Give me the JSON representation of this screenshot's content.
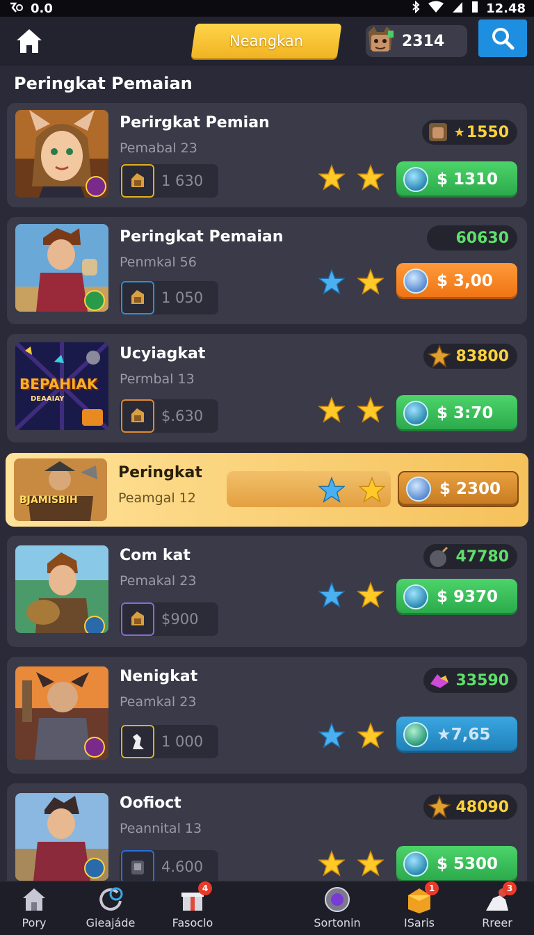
{
  "status": {
    "left_text": "0.0",
    "time": "12.48"
  },
  "header": {
    "tab_label": "Neangkan",
    "currency_value": "2314"
  },
  "section_title": "Peringkat Pemaian",
  "rows": [
    {
      "name": "Perirgkat Pemian",
      "sub": "Pemabal 23",
      "item_value": "1 630",
      "badge": "1550",
      "badge_color": "#ffd23a",
      "price": "$ 1310",
      "price_style": "green",
      "stars": [
        "gold",
        "gold"
      ]
    },
    {
      "name": "Peringkat Pemaian",
      "sub": "Penmkal 56",
      "item_value": "1 050",
      "badge": "60630",
      "badge_color": "#5ee06a",
      "price": "$ 3,00",
      "price_style": "orange",
      "stars": [
        "blue",
        "gold"
      ]
    },
    {
      "name": "Ucyiagkat",
      "sub": "Permbal 13",
      "item_value": "$.630",
      "badge": "83800",
      "badge_color": "#ffd23a",
      "price": "$ 3:70",
      "price_style": "green",
      "stars": [
        "gold",
        "gold"
      ]
    },
    {
      "name": "Peringkat",
      "sub": "Peamgal 12",
      "price": "$ 2300",
      "price_style": "gold",
      "stars": [
        "blue",
        "gold"
      ],
      "thumb_text": "BJAMISBIH"
    },
    {
      "name": "Com kat",
      "sub": "Pemakal 23",
      "item_value": "$900",
      "badge": "47780",
      "badge_color": "#5ee06a",
      "price": "$ 9370",
      "price_style": "green",
      "stars": [
        "blue",
        "gold"
      ]
    },
    {
      "name": "Nenigkat",
      "sub": "Peamkal 23",
      "item_value": "1 000",
      "badge": "33590",
      "badge_color": "#5ee06a",
      "price": "★7,65",
      "price_style": "blue",
      "stars": [
        "blue",
        "gold"
      ]
    },
    {
      "name": "Oofioct",
      "sub": "Peannital 13",
      "item_value": "4.600",
      "badge": "48090",
      "badge_color": "#ffd23a",
      "price": "$ 5300",
      "price_style": "green",
      "stars": [
        "gold",
        "gold"
      ]
    }
  ],
  "thumb3": {
    "title": "BEPAHIAK",
    "subtitle": "DEAAIAY"
  },
  "nav": [
    {
      "label": "Pory",
      "badge": ""
    },
    {
      "label": "Gieajáde",
      "badge": ""
    },
    {
      "label": "Fasoclo",
      "badge": "4"
    },
    {
      "label": "Sortonin",
      "badge": ""
    },
    {
      "label": "ISaris",
      "badge": "1"
    },
    {
      "label": "Rreer",
      "badge": "3"
    }
  ]
}
